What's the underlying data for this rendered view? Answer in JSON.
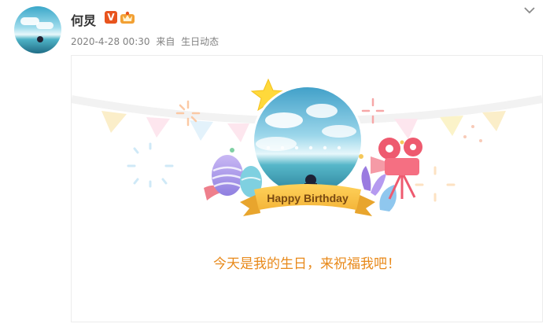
{
  "post": {
    "username": "何炅",
    "badge_v": "V",
    "time": "2020-4-28 00:30",
    "source_prefix": "来自",
    "source": "生日动态"
  },
  "card": {
    "banner_text": "Happy Birthday",
    "wish_text": "今天是我的生日，来祝福我吧！"
  },
  "icons": {
    "expand": "chevron-down-icon",
    "verified": "verified-v-icon",
    "member": "crown-icon"
  },
  "colors": {
    "username": "#333333",
    "meta": "#808080",
    "wish": "#e8891a",
    "badge": "#e8541e"
  }
}
